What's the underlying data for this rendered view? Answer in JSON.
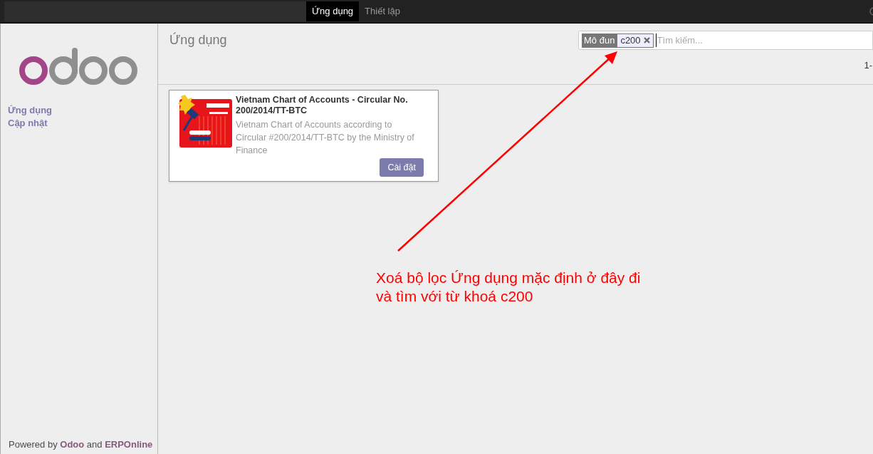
{
  "topbar": {
    "menus": [
      {
        "label": "Ứng dụng",
        "selected": true
      },
      {
        "label": "Thiết lập",
        "selected": false
      }
    ]
  },
  "sidebar": {
    "items": [
      {
        "label": "Ứng dụng"
      },
      {
        "label": "Cập nhật"
      }
    ],
    "footer": "Powered by **Odoo** and **ERPOnline**"
  },
  "main": {
    "title": "Ứng dụng",
    "search": {
      "facet_label": "Mô đun",
      "facet_value": "c200",
      "placeholder": "Tìm kiếm..."
    },
    "pager": "1-",
    "apps": [
      {
        "name": "Vietnam Chart of Accounts - Circular No. 200/2014/TT-BTC",
        "summary": "Vietnam Chart of Accounts according to Circular #200/2014/TT-BTC by the Ministry of Finance",
        "button": "Cài đặt"
      }
    ]
  },
  "annotation": {
    "lines": [
      "Xoá bộ lọc Ứng dụng mặc định ở đây đi",
      "và tìm với từ khoá c200"
    ]
  }
}
